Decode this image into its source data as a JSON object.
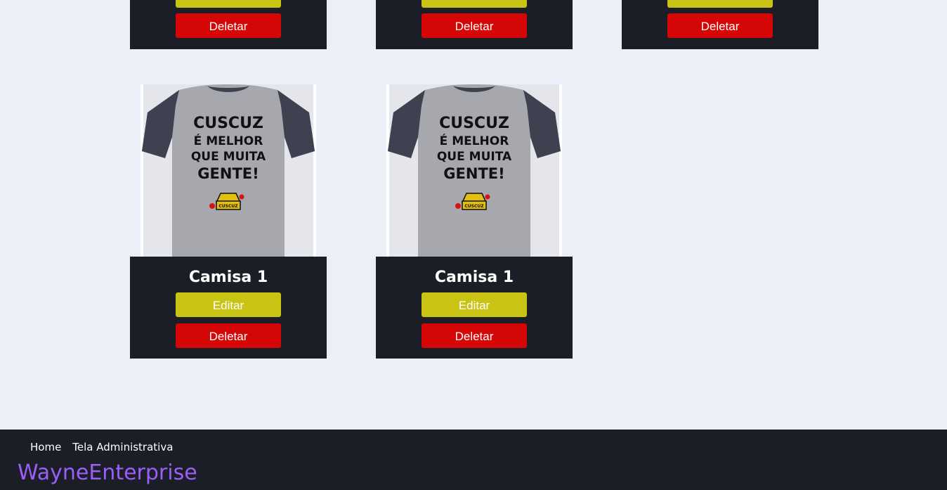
{
  "top_row": [
    {
      "delete_label": "Deletar"
    },
    {
      "delete_label": "Deletar"
    },
    {
      "delete_label": "Deletar"
    }
  ],
  "products": [
    {
      "name": "Camisa 1",
      "edit_label": "Editar",
      "delete_label": "Deletar",
      "image_text": [
        "CUSCUZ",
        "É MELHOR",
        "QUE MUITA",
        "GENTE!"
      ],
      "image_badge": "CUSCUZ"
    },
    {
      "name": "Camisa 1",
      "edit_label": "Editar",
      "delete_label": "Deletar",
      "image_text": [
        "CUSCUZ",
        "É MELHOR",
        "QUE MUITA",
        "GENTE!"
      ],
      "image_badge": "CUSCUZ"
    }
  ],
  "footer": {
    "nav": [
      "Home",
      "Tela Administrativa"
    ],
    "brand": "WayneEnterprise"
  },
  "colors": {
    "background": "#eaeff8",
    "card": "#1b1e27",
    "edit": "#c9c313",
    "delete": "#d40606",
    "brand": "#9b5ef7"
  }
}
